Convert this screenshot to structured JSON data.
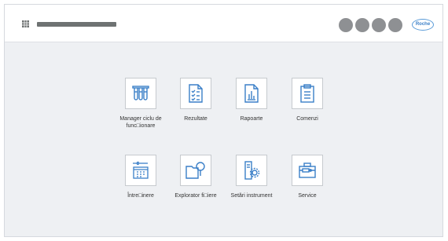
{
  "header": {
    "status_dots": 4,
    "logo_text": "Roche"
  },
  "tiles": [
    {
      "label": "Manager ciclu de func□ionare",
      "icon": "test-tubes-icon"
    },
    {
      "label": "Rezultate",
      "icon": "checklist-icon"
    },
    {
      "label": "Rapoarte",
      "icon": "report-chart-icon"
    },
    {
      "label": "Comenzi",
      "icon": "clipboard-icon"
    },
    {
      "label": "Între□inere",
      "icon": "maintenance-calendar-icon"
    },
    {
      "label": "Explorator fi□iere",
      "icon": "folder-search-icon"
    },
    {
      "label": "Setări instrument",
      "icon": "instrument-settings-icon"
    },
    {
      "label": "Service",
      "icon": "toolbox-icon"
    }
  ],
  "colors": {
    "background": "#eef0f3",
    "icon_blue": "#3a7fc8",
    "dot_gray": "#8e9093"
  }
}
